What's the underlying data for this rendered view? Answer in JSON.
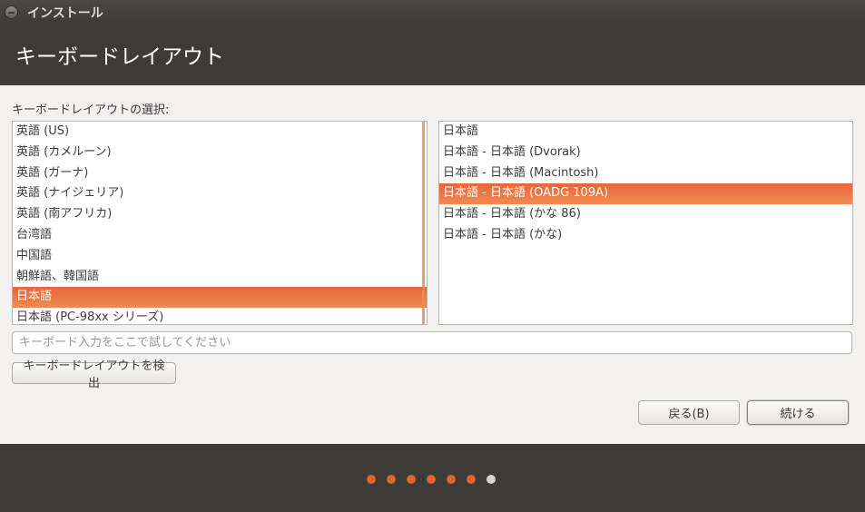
{
  "window": {
    "title": "インストール"
  },
  "header": {
    "title": "キーボードレイアウト"
  },
  "layout_choice": {
    "label": "キーボードレイアウトの選択:"
  },
  "layouts": [
    {
      "label": "英語 (US)",
      "selected": false
    },
    {
      "label": "英語 (カメルーン)",
      "selected": false
    },
    {
      "label": "英語 (ガーナ)",
      "selected": false
    },
    {
      "label": "英語 (ナイジェリア)",
      "selected": false
    },
    {
      "label": "英語 (南アフリカ)",
      "selected": false
    },
    {
      "label": "台湾語",
      "selected": false
    },
    {
      "label": "中国語",
      "selected": false
    },
    {
      "label": "朝鮮語、韓国語",
      "selected": false
    },
    {
      "label": "日本語",
      "selected": true
    },
    {
      "label": "日本語 (PC-98xx シリーズ)",
      "selected": false
    }
  ],
  "variants": [
    {
      "label": "日本語",
      "selected": false
    },
    {
      "label": "日本語 - 日本語 (Dvorak)",
      "selected": false
    },
    {
      "label": "日本語 - 日本語 (Macintosh)",
      "selected": false
    },
    {
      "label": "日本語 - 日本語 (OADG 109A)",
      "selected": true
    },
    {
      "label": "日本語 - 日本語 (かな 86)",
      "selected": false
    },
    {
      "label": "日本語 - 日本語 (かな)",
      "selected": false
    }
  ],
  "test_input": {
    "value": "",
    "placeholder": "キーボード入力をここで試してください"
  },
  "buttons": {
    "detect": "キーボードレイアウトを検出",
    "back": "戻る(B)",
    "continue": "続ける"
  },
  "progress": {
    "total_steps": 7,
    "completed_steps": 6
  },
  "colors": {
    "accent": "#e8663b",
    "dark_bg": "#3c3b37",
    "panel_bg": "#f2f1f0",
    "dot_done": "#e0642d",
    "dot_pending": "#d7d5d1"
  }
}
